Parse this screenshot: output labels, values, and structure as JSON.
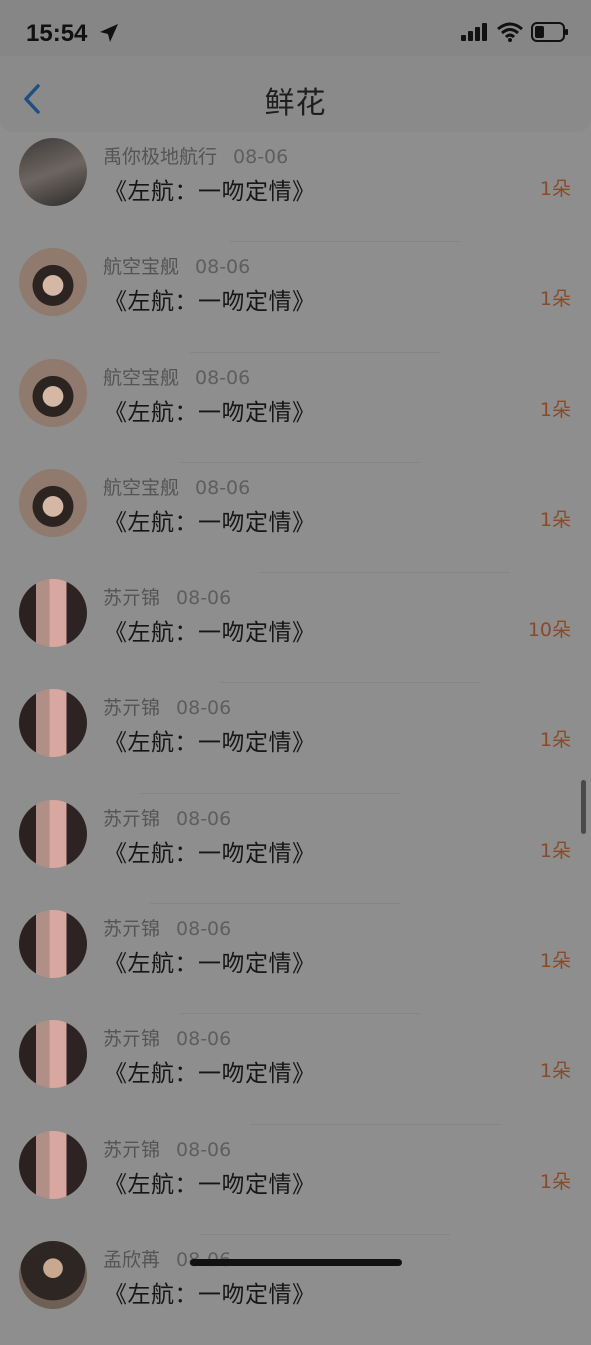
{
  "status": {
    "time": "15:54"
  },
  "nav": {
    "title": "鲜花"
  },
  "items": [
    {
      "name": "禹你极地航行",
      "date": "08-06",
      "book": "《左航：一吻定情》",
      "count": "1朵",
      "avatar": "night"
    },
    {
      "name": "航空宝舰",
      "date": "08-06",
      "book": "《左航：一吻定情》",
      "count": "1朵",
      "avatar": "bear"
    },
    {
      "name": "航空宝舰",
      "date": "08-06",
      "book": "《左航：一吻定情》",
      "count": "1朵",
      "avatar": "bear"
    },
    {
      "name": "航空宝舰",
      "date": "08-06",
      "book": "《左航：一吻定情》",
      "count": "1朵",
      "avatar": "bear"
    },
    {
      "name": "苏亓锦",
      "date": "08-06",
      "book": "《左航：一吻定情》",
      "count": "10朵",
      "avatar": "mirror"
    },
    {
      "name": "苏亓锦",
      "date": "08-06",
      "book": "《左航：一吻定情》",
      "count": "1朵",
      "avatar": "mirror"
    },
    {
      "name": "苏亓锦",
      "date": "08-06",
      "book": "《左航：一吻定情》",
      "count": "1朵",
      "avatar": "mirror"
    },
    {
      "name": "苏亓锦",
      "date": "08-06",
      "book": "《左航：一吻定情》",
      "count": "1朵",
      "avatar": "mirror"
    },
    {
      "name": "苏亓锦",
      "date": "08-06",
      "book": "《左航：一吻定情》",
      "count": "1朵",
      "avatar": "mirror"
    },
    {
      "name": "苏亓锦",
      "date": "08-06",
      "book": "《左航：一吻定情》",
      "count": "1朵",
      "avatar": "mirror"
    },
    {
      "name": "孟欣苒",
      "date": "08-06",
      "book": "《左航：一吻定情》",
      "count": "",
      "avatar": "hair-dark"
    }
  ]
}
